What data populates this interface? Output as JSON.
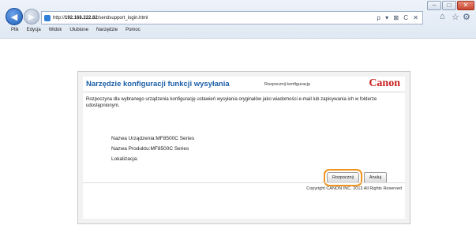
{
  "browser": {
    "url_prefix": "http://",
    "url_host": "192.168.222.82",
    "url_path": "/sendsupport_login.html",
    "address_tools": "ρ ▾ ⊠ C ✕",
    "menu": [
      "Plik",
      "Edycja",
      "Widok",
      "Ulubione",
      "Narzędzie",
      "Pomoc"
    ]
  },
  "dialog": {
    "title": "Narzędzie konfiguracji funkcji wysyłania",
    "subtitle": "Rozpocznij konfigurację",
    "logo": "Canon",
    "description": "Rozpoczyna dla wybranego urządzenia konfigurację ustawień wysyłania oryginałów jako wiadomości e-mail lub zapisywania ich w folderze udostępnionym.",
    "device_name": "Nazwa Urządzenia:MF8500C Series",
    "product_name": "Nazwa Produktu:MF8500C Series",
    "location": "Lokalizacja:",
    "start_button": "Rozpocznij",
    "cancel_button": "Anuluj",
    "copyright": "Copyright CANON INC. 2013 All Rights Reserved"
  }
}
